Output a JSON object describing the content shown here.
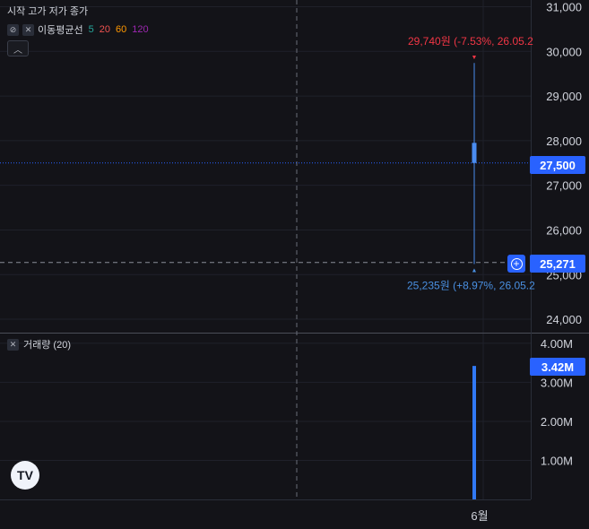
{
  "legend": {
    "ohlc_label": "시작 고가 저가 종가",
    "ma_name": "이동평균선",
    "ma_periods": [
      {
        "label": "5",
        "color": "#26a69a"
      },
      {
        "label": "20",
        "color": "#ef5350"
      },
      {
        "label": "60",
        "color": "#ff9800"
      },
      {
        "label": "120",
        "color": "#9c27b0"
      }
    ],
    "collapse_icon": "chevron-up-icon",
    "visibility_icon": "eye-off-icon",
    "close_icon": "close-icon"
  },
  "volume_legend": {
    "label": "거래량 (20)"
  },
  "annotations": {
    "high_label": "29,740원 (-7.53%, 26.05.2",
    "low_label": "25,235원 (+8.97%, 26.05.2"
  },
  "price_tags": {
    "last_price": "27,500",
    "crosshair_price": "25,271",
    "volume_last": "3.42M"
  },
  "colors": {
    "background": "#131318",
    "accent": "#2962ff",
    "candle": "#4a8cf0",
    "high_annotation": "#f23645",
    "low_annotation": "#4a90e2"
  },
  "chart_data": {
    "type": "candlestick",
    "price_axis": {
      "ticks": [
        "31,000",
        "30,000",
        "29,000",
        "28,000",
        "27,000",
        "26,000",
        "25,000",
        "24,000"
      ],
      "ylim": [
        23700,
        31150
      ]
    },
    "volume_axis": {
      "ticks": [
        "4.00M",
        "3.00M",
        "2.00M",
        "1.00M"
      ],
      "ylim": [
        0,
        4.25
      ]
    },
    "x_axis": {
      "ticks": [
        "6월"
      ]
    },
    "candles": [
      {
        "x": "6월",
        "open": 27500,
        "high": 29740,
        "low": 25235,
        "close": 27950,
        "volume_m": 3.42
      }
    ],
    "last_price": 27500,
    "crosshair_price": 25271,
    "grid": true
  }
}
